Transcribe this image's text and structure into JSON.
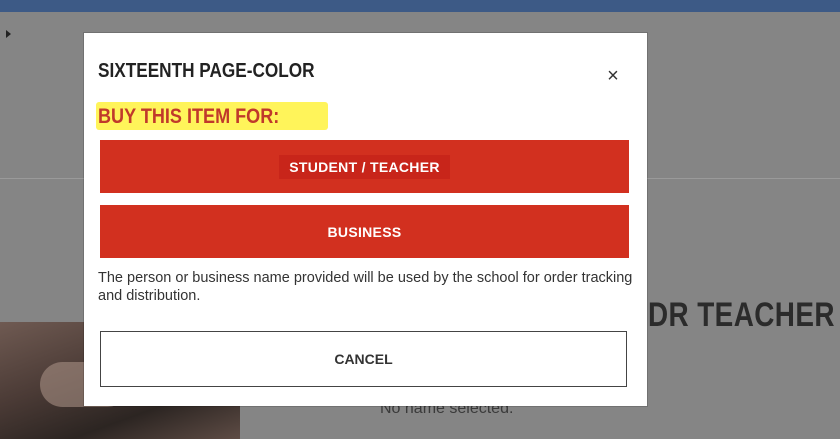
{
  "background": {
    "heading_fragment": "DR TEACHER",
    "status_text": "No name selected."
  },
  "modal": {
    "title": "SIXTEENTH PAGE-COLOR",
    "close_icon": "×",
    "prompt": "BUY THIS ITEM FOR:",
    "options": [
      {
        "label": "STUDENT / TEACHER"
      },
      {
        "label": "BUSINESS"
      }
    ],
    "note": "The person or business name provided will be used by the school for order tracking and distribution.",
    "cancel_label": "CANCEL"
  },
  "colors": {
    "accent_red": "#d2301f",
    "highlight_yellow": "#fff45a",
    "prompt_text": "#c0392b"
  }
}
